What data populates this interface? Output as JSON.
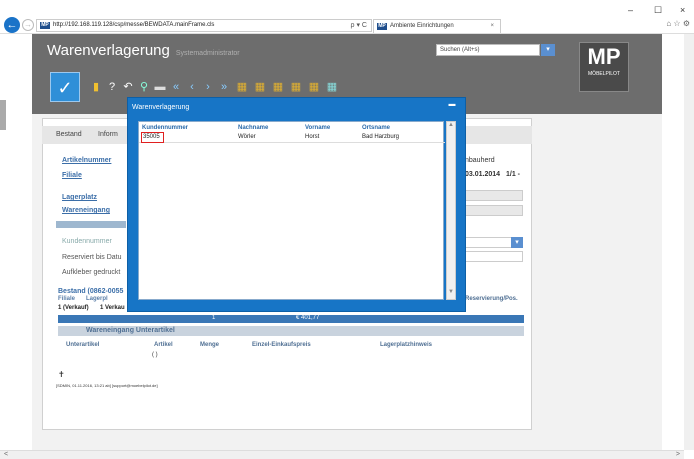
{
  "browser": {
    "url": "http://192.168.119.128/csp/messe/BEWDATA.mainFrame.cls",
    "tab_title": "Ambiente Einrichtungen",
    "favicon_text": "MP",
    "back_icon": "←",
    "forward_icon": "→",
    "address_tools": "ρ ▾ C",
    "tab_close": "×",
    "minimize": "–",
    "maximize": "☐",
    "close": "×",
    "right_icons": "⌂ ☆ ⚙"
  },
  "app": {
    "title": "Warenverlagerung",
    "user": "Systemadministrator",
    "search_placeholder": "Suchen (Alt+s)",
    "search_icon": "▾",
    "logo_text": "MP",
    "logo_sub": "MÖBELPILOT",
    "check_icon": "✓",
    "toolbar_icons": [
      "▮",
      "?",
      "↶",
      "⚲",
      "▬",
      "«",
      "‹",
      "›",
      "»",
      "▦",
      "▦",
      "▦",
      "▦",
      "▦",
      "▦"
    ]
  },
  "tabs": [
    "Bestand",
    "Inform"
  ],
  "fields": {
    "artikelnummer": "Artikelnummer",
    "filiale": "Filiale",
    "lagerplatz": "Lagerplatz",
    "wareneingang": "Wareneingang",
    "kundennummer": "Kundennummer",
    "reserviert": "Reserviert bis Datu",
    "aufkleber": "Aufkleber gedruckt",
    "right_top": "nbauherd",
    "right_date": "03.01.2014",
    "right_page": "1/1 -",
    "reservierung_pos": "Reservierung/Pos."
  },
  "bestand": {
    "title": "Bestand (0862-0055",
    "header_cols": [
      "Filiale",
      "Lagerpl"
    ],
    "row_cols": [
      "1 (Verkauf)",
      "1 Verkau"
    ],
    "bar_left": "1",
    "bar_value": "€ 401,77"
  },
  "wareneingang_unterartikel": {
    "label": "Wareneingang Unterartikel",
    "headers": [
      "Unterartikel",
      "Artikel",
      "Menge",
      "Einzel-Einkaufspreis",
      "Lagerplatzhinweis"
    ],
    "row_artikel": "( )"
  },
  "footer": {
    "pin": "✝",
    "text": "[SDMIN, 01.11.2016, 13:21 ab] [support@moebelpilot.de]"
  },
  "modal": {
    "title": "Warenverlagerung",
    "close_icon": "▬",
    "columns": [
      "Kundennummer",
      "Nachname",
      "Vorname",
      "Ortsname"
    ],
    "rows": [
      {
        "kundennummer": "35005",
        "nachname": "Wörler",
        "vorname": "Horst",
        "ortsname": "Bad Harzburg"
      }
    ],
    "scroll_up": "▲",
    "scroll_down": "▼"
  },
  "scroll": {
    "left": "<",
    "right": ">"
  }
}
